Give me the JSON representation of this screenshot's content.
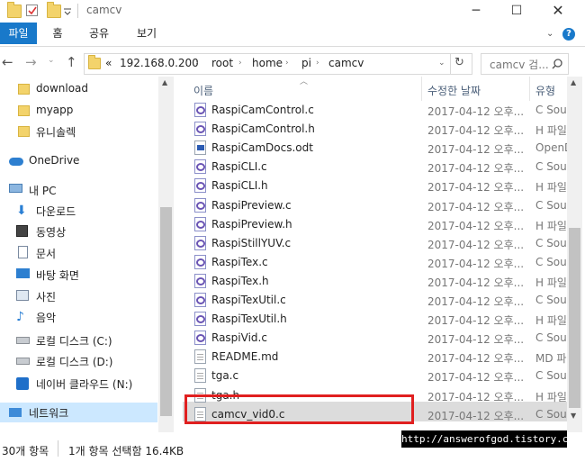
{
  "window": {
    "title": "camcv"
  },
  "ribbon": {
    "tabs": [
      "파일",
      "홈",
      "공유",
      "보기"
    ],
    "help": "?"
  },
  "address": {
    "prefix": "«",
    "crumbs": [
      "192.168.0.200",
      "root",
      "home",
      "pi",
      "camcv"
    ],
    "refresh": "↻"
  },
  "search": {
    "placeholder": "camcv 검..."
  },
  "nav": {
    "items": [
      {
        "label": "download",
        "icon": "folder-icon"
      },
      {
        "label": "myapp",
        "icon": "folder-icon"
      },
      {
        "label": "유니솔렉",
        "icon": "folder-icon"
      },
      {
        "label": "OneDrive",
        "icon": "onedrive-icon"
      },
      {
        "label": "내 PC",
        "icon": "pc-icon"
      },
      {
        "label": "다운로드",
        "icon": "download-icon"
      },
      {
        "label": "동영상",
        "icon": "video-icon"
      },
      {
        "label": "문서",
        "icon": "document-icon"
      },
      {
        "label": "바탕 화면",
        "icon": "desktop-icon"
      },
      {
        "label": "사진",
        "icon": "pictures-icon"
      },
      {
        "label": "음악",
        "icon": "music-icon"
      },
      {
        "label": "로컬 디스크 (C:)",
        "icon": "drive-icon"
      },
      {
        "label": "로컬 디스크 (D:)",
        "icon": "drive-icon"
      },
      {
        "label": "네이버 클라우드 (N:)",
        "icon": "cloud-icon"
      },
      {
        "label": "네트워크",
        "icon": "network-icon"
      }
    ]
  },
  "list": {
    "headers": {
      "name": "이름",
      "date": "수정한 날짜",
      "type": "유형"
    },
    "files": [
      {
        "name": "RaspiCamControl.c",
        "date": "2017-04-12 오후...",
        "type": "C Sou",
        "icon": "vs"
      },
      {
        "name": "RaspiCamControl.h",
        "date": "2017-04-12 오후...",
        "type": "H 파일",
        "icon": "vs"
      },
      {
        "name": "RaspiCamDocs.odt",
        "date": "2017-04-12 오후...",
        "type": "OpenD",
        "icon": "odt"
      },
      {
        "name": "RaspiCLI.c",
        "date": "2017-04-12 오후...",
        "type": "C Sou",
        "icon": "vs"
      },
      {
        "name": "RaspiCLI.h",
        "date": "2017-04-12 오후...",
        "type": "H 파일",
        "icon": "vs"
      },
      {
        "name": "RaspiPreview.c",
        "date": "2017-04-12 오후...",
        "type": "C Sou",
        "icon": "vs"
      },
      {
        "name": "RaspiPreview.h",
        "date": "2017-04-12 오후...",
        "type": "H 파일",
        "icon": "vs"
      },
      {
        "name": "RaspiStillYUV.c",
        "date": "2017-04-12 오후...",
        "type": "C Sou",
        "icon": "vs"
      },
      {
        "name": "RaspiTex.c",
        "date": "2017-04-12 오후...",
        "type": "C Sou",
        "icon": "vs"
      },
      {
        "name": "RaspiTex.h",
        "date": "2017-04-12 오후...",
        "type": "H 파일",
        "icon": "vs"
      },
      {
        "name": "RaspiTexUtil.c",
        "date": "2017-04-12 오후...",
        "type": "C Sou",
        "icon": "vs"
      },
      {
        "name": "RaspiTexUtil.h",
        "date": "2017-04-12 오후...",
        "type": "H 파일",
        "icon": "vs"
      },
      {
        "name": "RaspiVid.c",
        "date": "2017-04-12 오후...",
        "type": "C Sou",
        "icon": "vs"
      },
      {
        "name": "README.md",
        "date": "2017-04-12 오후...",
        "type": "MD 파",
        "icon": "txt"
      },
      {
        "name": "tga.c",
        "date": "2017-04-12 오후...",
        "type": "C Sou",
        "icon": "txt"
      },
      {
        "name": "tga.h",
        "date": "2017-04-12 오후...",
        "type": "H 파일",
        "icon": "txt"
      },
      {
        "name": "camcv_vid0.c",
        "date": "2017-04-12 오후...",
        "type": "C Sou",
        "icon": "txt"
      }
    ]
  },
  "status": {
    "count": "30개 항목",
    "selection": "1개 항목 선택함 16.4KB"
  },
  "watermark": "http://answerofgod.tistory.com",
  "colors": {
    "accent": "#1979ca",
    "highlight_box": "#e02020",
    "selected": "#cce8ff"
  }
}
